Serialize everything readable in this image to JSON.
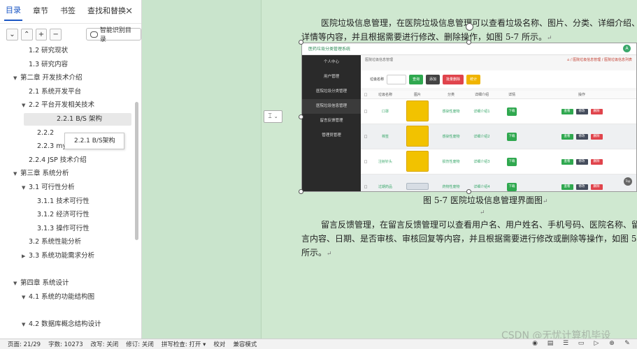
{
  "nav": {
    "tabs": [
      {
        "label": "目录",
        "active": true
      },
      {
        "label": "章节",
        "active": false
      },
      {
        "label": "书签",
        "active": false
      },
      {
        "label": "查找和替换",
        "active": false
      }
    ],
    "close_icon": "close-icon",
    "tools": {
      "collapse": "⌄",
      "expand": "⌃",
      "add": "+",
      "remove": "−",
      "smart_label": "智能识别目录"
    },
    "toc": [
      {
        "text": "1.2  研究现状",
        "level": 2,
        "expanded": null,
        "selected": false
      },
      {
        "text": "1.3  研究内容",
        "level": 2,
        "expanded": null,
        "selected": false
      },
      {
        "text": "第二章  开发技术介绍",
        "level": 1,
        "expanded": true,
        "selected": false
      },
      {
        "text": "2.1   系统开发平台",
        "level": 2,
        "expanded": null,
        "selected": false
      },
      {
        "text": "2.2  平台开发相关技术",
        "level": 2,
        "expanded": true,
        "selected": false
      },
      {
        "text": "2.2.1    B/S 架构",
        "level": 3,
        "expanded": null,
        "selected": true
      },
      {
        "text": "2.2.2",
        "level": 3,
        "expanded": null,
        "selected": false
      },
      {
        "text": "2.2.3  mysql 数据库介绍",
        "level": 3,
        "expanded": null,
        "selected": false
      },
      {
        "text": "2.2.4  JSP 技术介绍",
        "level": 2,
        "expanded": null,
        "selected": false
      },
      {
        "text": "第三章  系统分析",
        "level": 1,
        "expanded": true,
        "selected": false
      },
      {
        "text": "3.1  可行性分析",
        "level": 2,
        "expanded": true,
        "selected": false
      },
      {
        "text": "3.1.1    技术可行性",
        "level": 3,
        "expanded": null,
        "selected": false
      },
      {
        "text": "3.1.2  经济可行性",
        "level": 3,
        "expanded": null,
        "selected": false
      },
      {
        "text": "3.1.3  操作可行性",
        "level": 3,
        "expanded": null,
        "selected": false
      },
      {
        "text": "3.2  系统性能分析",
        "level": 2,
        "expanded": null,
        "selected": false
      },
      {
        "text": "3.3  系统功能需求分析",
        "level": 2,
        "expanded": false,
        "selected": false
      },
      {
        "text": "",
        "level": 0,
        "expanded": null,
        "selected": false
      },
      {
        "text": "第四章  系统设计",
        "level": 1,
        "expanded": true,
        "selected": false
      },
      {
        "text": "4.1  系统的功能结构图",
        "level": 2,
        "expanded": true,
        "selected": false
      },
      {
        "text": "",
        "level": 0,
        "expanded": null,
        "selected": false
      },
      {
        "text": "4.2  数据库概念结构设计",
        "level": 2,
        "expanded": true,
        "selected": false
      }
    ],
    "tooltip": "2.2.1  B/S架构"
  },
  "document": {
    "para1_line1": "医院垃圾信息管理，在医院垃圾信息管理可以查看垃圾名称、图片、分类、详细介绍、",
    "para1_line2": "详情等内容，并且根据需要进行修改、删除操作，如图 5-7 所示。",
    "caption": "图 5-7 医院垃圾信息管理界面图",
    "para2_line1": "留言反馈管理，在留言反馈管理可以查看用户名、用户姓名、手机号码、医院名称、留",
    "para2_line2": "言内容、日期、是否审核、审核回复等内容，并且根据需要进行修改或删除等操作，如图 5-8",
    "para2_line3": "所示。",
    "para_mark": "↵"
  },
  "figure": {
    "app_title": "医药垃圾分类管理系统",
    "avatar": "A",
    "sidebar": [
      "个人中心",
      "用户管理",
      "医院垃圾分类管理",
      "医院垃圾信息管理",
      "留言反馈管理",
      "管理员管理"
    ],
    "sidebar_active_index": 3,
    "breadcrumb_left": "医院垃圾信息管理",
    "breadcrumb_right": "⌂ / 医院垃圾信息管理 / 医院垃圾信息列表",
    "search_label": "垃圾名称",
    "buttons": [
      {
        "label": "查询",
        "color": "#2fa84f"
      },
      {
        "label": "添加",
        "color": "#444444"
      },
      {
        "label": "批量删除",
        "color": "#e0444c"
      },
      {
        "label": "统计",
        "color": "#f0b400"
      }
    ],
    "columns": [
      "",
      "垃圾名称",
      "图片",
      "分类",
      "详细介绍",
      "详情",
      "操作"
    ],
    "rows": [
      {
        "name": "口罩",
        "category": "感染性废物",
        "detail": "详细介绍1",
        "thumb": "bin"
      },
      {
        "name": "棉签",
        "category": "感染性废物",
        "detail": "详细介绍2",
        "thumb": "bin"
      },
      {
        "name": "注射针头",
        "category": "损伤性废物",
        "detail": "详细介绍3",
        "thumb": "bin"
      },
      {
        "name": "过期药品",
        "category": "药物性废物",
        "detail": "详细介绍4",
        "thumb": "shelf"
      }
    ],
    "detail_btn": "下载",
    "ops": [
      {
        "label": "查看",
        "color": "#2fa84f"
      },
      {
        "label": "修改",
        "color": "#444c5c"
      },
      {
        "label": "删除",
        "color": "#e0444c"
      }
    ],
    "top_btn": "Top"
  },
  "layout_options_icon": "⌶",
  "watermark": "CSDN @无忧计算机毕设",
  "status": {
    "page": "页面: 21/29",
    "words": "字数: 10273",
    "revise": "改写: 关闭",
    "track": "修订: 关闭",
    "spell": "拼写检查: 打开 ▾",
    "proof": "校对",
    "compat": "兼容模式"
  },
  "status_icons": [
    "eye-icon",
    "page-view-icon",
    "outline-icon",
    "web-layout-icon",
    "play-icon",
    "globe-icon",
    "pen-icon"
  ]
}
